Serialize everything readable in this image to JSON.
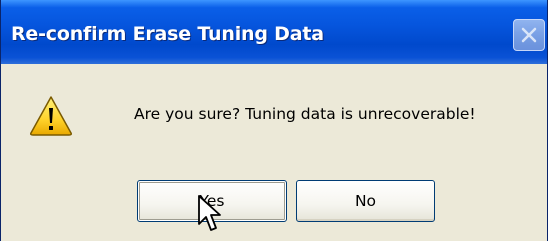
{
  "window": {
    "title": "Re-confirm Erase Tuning Data"
  },
  "dialog": {
    "icon": "warning-icon",
    "message": "Are you sure?  Tuning data is unrecoverable!",
    "buttons": {
      "yes_label": "Yes",
      "no_label": "No"
    }
  },
  "colors": {
    "titlebar": "#0655dd",
    "dialog_background": "#ece9d8",
    "warning_yellow": "#ffd22a"
  }
}
